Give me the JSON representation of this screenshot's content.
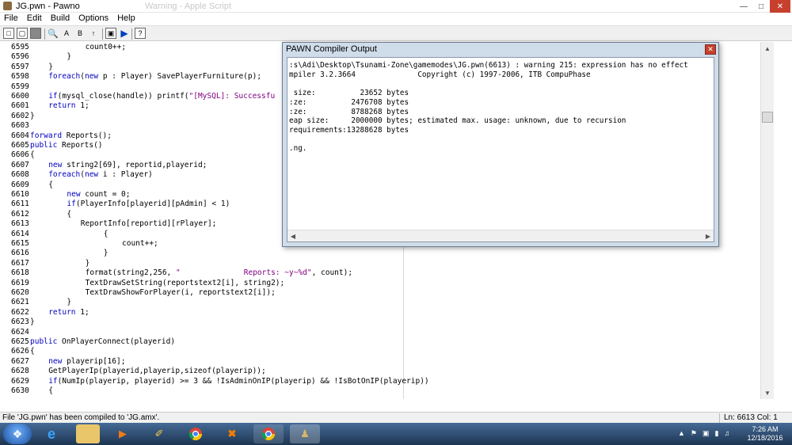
{
  "window": {
    "title": "JG.pwn - Pawno",
    "ghost_title": "Warning - Apple Script"
  },
  "menu": [
    "File",
    "Edit",
    "Build",
    "Options",
    "Help"
  ],
  "toolbar_icons": [
    "new-file-icon",
    "open-file-icon",
    "save-file-icon",
    "find-icon",
    "find-next-icon",
    "replace-icon",
    "goto-icon",
    "font-icon",
    "compile-icon",
    "run-icon",
    "help-icon"
  ],
  "code": [
    {
      "ln": "6595",
      "indent": 12,
      "text": "count0++;"
    },
    {
      "ln": "6596",
      "indent": 8,
      "text": "}"
    },
    {
      "ln": "6597",
      "indent": 4,
      "text": "}"
    },
    {
      "ln": "6598",
      "indent": 4,
      "text": "foreach(new p : Player) SavePlayerFurniture(p);"
    },
    {
      "ln": "6599",
      "indent": 0,
      "text": ""
    },
    {
      "ln": "6600",
      "indent": 4,
      "text": "if(mysql_close(handle)) printf(\"[MySQL]: Successfu"
    },
    {
      "ln": "6601",
      "indent": 4,
      "text": "return 1;"
    },
    {
      "ln": "6602",
      "indent": 0,
      "text": "}"
    },
    {
      "ln": "6603",
      "indent": 0,
      "text": ""
    },
    {
      "ln": "6604",
      "indent": 0,
      "text": "forward Reports();"
    },
    {
      "ln": "6605",
      "indent": 0,
      "text": "public Reports()"
    },
    {
      "ln": "6606",
      "indent": 0,
      "text": "{"
    },
    {
      "ln": "6607",
      "indent": 4,
      "text": "new string2[69], reportid,playerid;"
    },
    {
      "ln": "6608",
      "indent": 4,
      "text": "foreach(new i : Player)"
    },
    {
      "ln": "6609",
      "indent": 4,
      "text": "{"
    },
    {
      "ln": "6610",
      "indent": 8,
      "text": "new count = 0;"
    },
    {
      "ln": "6611",
      "indent": 8,
      "text": "if(PlayerInfo[playerid][pAdmin] < 1)"
    },
    {
      "ln": "6612",
      "indent": 8,
      "text": "{"
    },
    {
      "ln": "6613",
      "indent": 11,
      "text": "ReportInfo[reportid][rPlayer];"
    },
    {
      "ln": "6614",
      "indent": 16,
      "text": "{"
    },
    {
      "ln": "6615",
      "indent": 20,
      "text": "count++;"
    },
    {
      "ln": "6616",
      "indent": 16,
      "text": "}"
    },
    {
      "ln": "6617",
      "indent": 12,
      "text": "}"
    },
    {
      "ln": "6618",
      "indent": 12,
      "text": "format(string2,256, \"              Reports: ~y~%d\", count);"
    },
    {
      "ln": "6619",
      "indent": 12,
      "text": "TextDrawSetString(reportstext2[i], string2);"
    },
    {
      "ln": "6620",
      "indent": 12,
      "text": "TextDrawShowForPlayer(i, reportstext2[i]);"
    },
    {
      "ln": "6621",
      "indent": 8,
      "text": "}"
    },
    {
      "ln": "6622",
      "indent": 4,
      "text": "return 1;"
    },
    {
      "ln": "6623",
      "indent": 0,
      "text": "}"
    },
    {
      "ln": "6624",
      "indent": 0,
      "text": ""
    },
    {
      "ln": "6625",
      "indent": 0,
      "text": "public OnPlayerConnect(playerid)"
    },
    {
      "ln": "6626",
      "indent": 0,
      "text": "{"
    },
    {
      "ln": "6627",
      "indent": 4,
      "text": "new playerip[16];"
    },
    {
      "ln": "6628",
      "indent": 4,
      "text": "GetPlayerIp(playerid,playerip,sizeof(playerip));"
    },
    {
      "ln": "6629",
      "indent": 4,
      "text": "if(NumIp(playerip, playerid) >= 3 && !IsAdminOnIP(playerip) && !IsBotOnIP(playerip))"
    },
    {
      "ln": "6630",
      "indent": 4,
      "text": "{"
    }
  ],
  "compiler": {
    "title": "PAWN Compiler Output",
    "lines": [
      ":s\\Adi\\Desktop\\Tsunami-Zone\\gamemodes\\JG.pwn(6613) : warning 215: expression has no effect",
      "mpiler 3.2.3664              Copyright (c) 1997-2006, ITB CompuPhase",
      "",
      " size:          23652 bytes",
      ":ze:          2476708 bytes",
      ":ze:          8788268 bytes",
      "eap size:     2000000 bytes; estimated max. usage: unknown, due to recursion",
      "requirements:13288628 bytes",
      "",
      ".ng."
    ]
  },
  "status": {
    "message": "File 'JG.pwn' has been compiled to 'JG.amx'.",
    "position": "Ln: 6613  Col: 1"
  },
  "taskbar": {
    "apps": [
      "ie-icon",
      "explorer-icon",
      "media-player-icon",
      "paint-icon",
      "chrome-icon",
      "xampp-icon",
      "chrome-icon-2",
      "pawno-icon"
    ],
    "time": "7:26 AM",
    "date": "12/18/2016"
  },
  "colors": {
    "keyword": "#0000c0",
    "string": "#800080",
    "taskbar": "#2a4a6e"
  }
}
